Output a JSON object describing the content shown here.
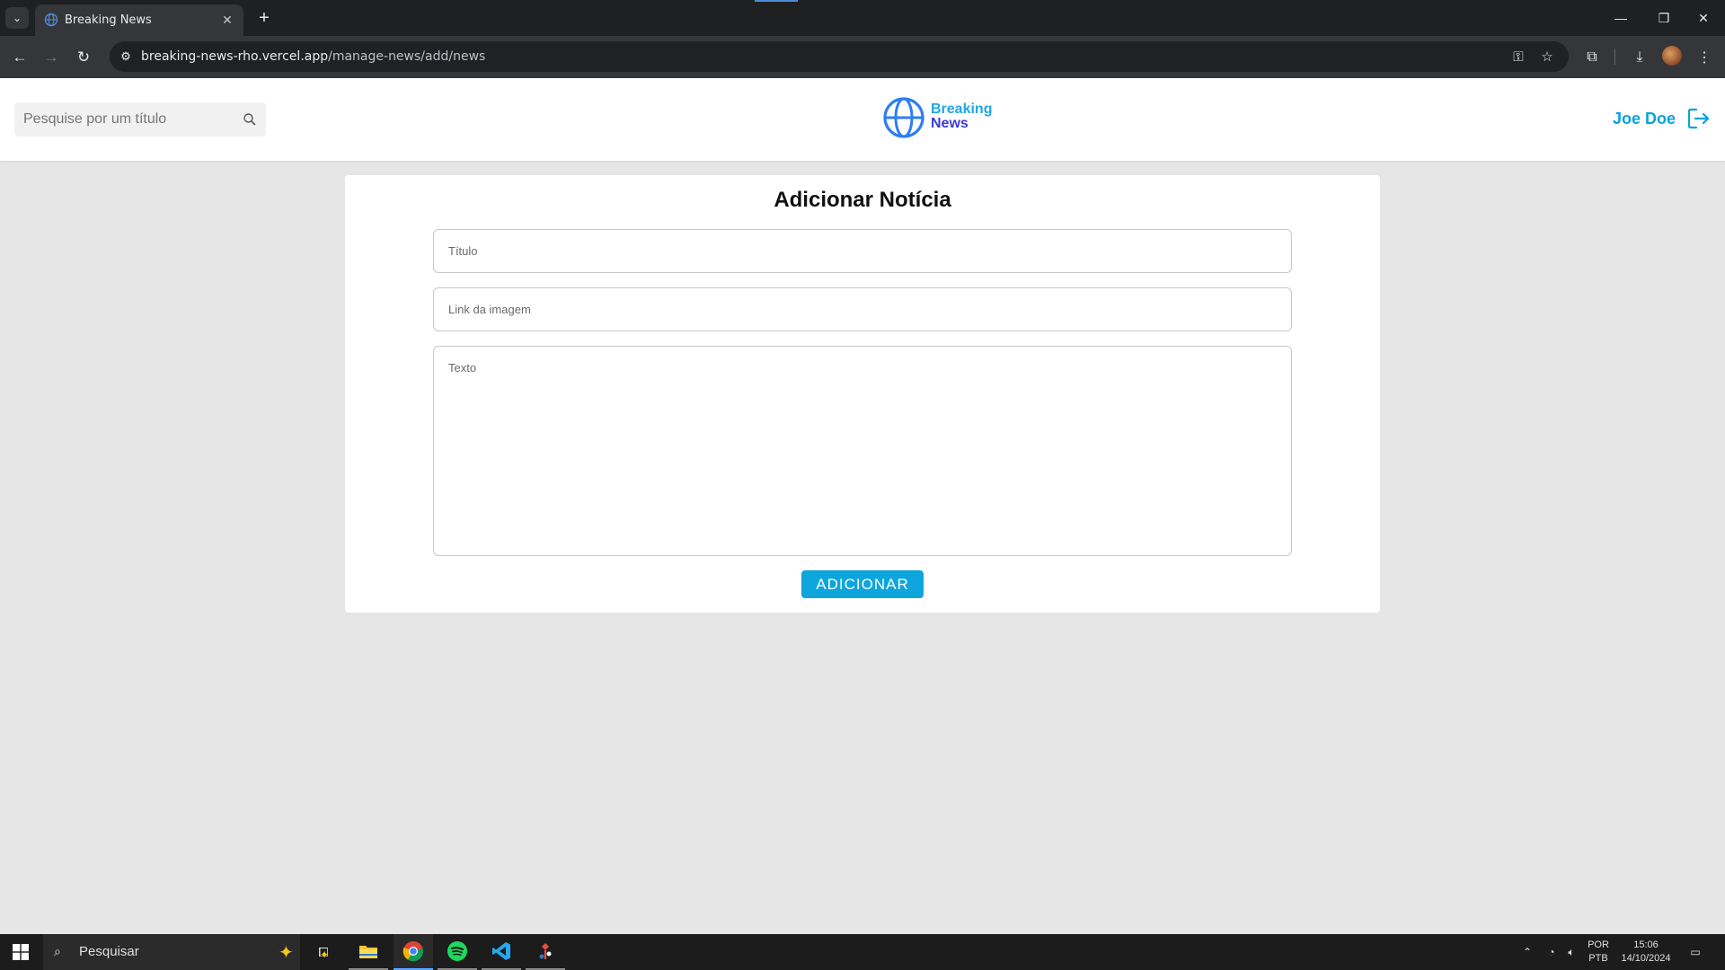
{
  "browser": {
    "tab_title": "Breaking News",
    "tab_close": "✕",
    "new_tab": "+",
    "url_host": "breaking-news-rho.vercel.app",
    "url_path": "/manage-news/add/news",
    "win_min": "—",
    "win_restore": "❐",
    "win_close": "✕"
  },
  "header": {
    "search_placeholder": "Pesquise por um título",
    "logo_line1": "Breaking",
    "logo_line2": "News",
    "user_name": "Joe Doe"
  },
  "form": {
    "heading": "Adicionar Notícia",
    "title_placeholder": "Título",
    "image_placeholder": "Link da imagem",
    "text_placeholder": "Texto",
    "submit_label": "ADICIONAR"
  },
  "taskbar": {
    "search_label": "Pesquisar",
    "apps": [
      "file-explorer",
      "chrome",
      "spotify",
      "vscode",
      "git-tool"
    ],
    "lang_line1": "POR",
    "lang_line2": "PTB",
    "time": "15:06",
    "date": "14/10/2024"
  },
  "colors": {
    "accent": "#0ea5dd",
    "logo_blue": "#1ea7e4",
    "logo_indigo": "#3a3ad9",
    "page_bg": "#e6e6e6"
  }
}
